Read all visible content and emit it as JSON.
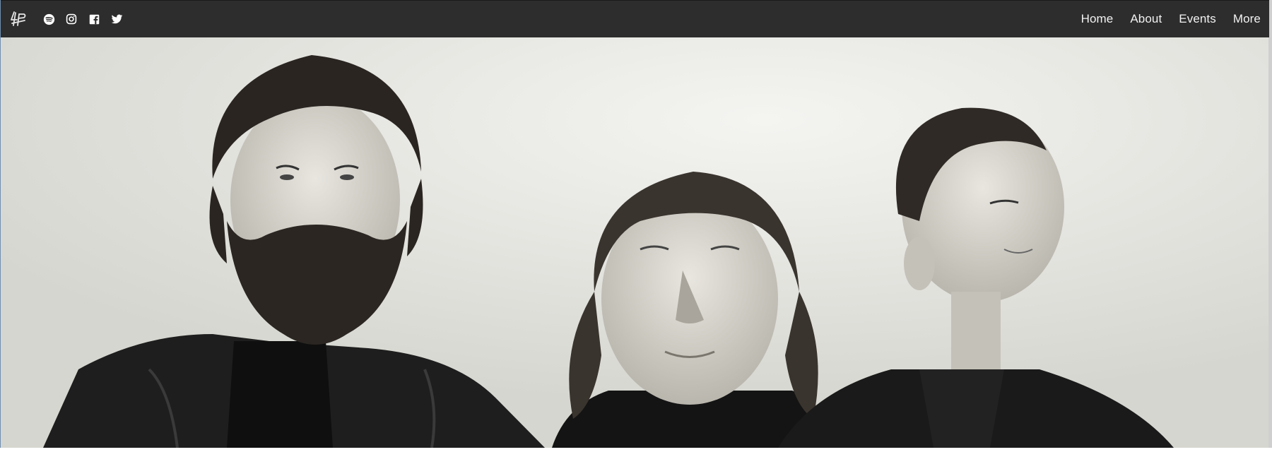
{
  "brand": {
    "logo_icon": "band-monogram-logo"
  },
  "social": [
    {
      "icon": "spotify-icon"
    },
    {
      "icon": "instagram-icon"
    },
    {
      "icon": "facebook-icon"
    },
    {
      "icon": "twitter-icon"
    }
  ],
  "nav": {
    "home": "Home",
    "about": "About",
    "events": "Events",
    "more": "More"
  },
  "hero": {
    "image": "black-and-white band photo of three men"
  },
  "colors": {
    "navbar": "#2d2d2d",
    "nav_text": "#f2f2f2"
  }
}
